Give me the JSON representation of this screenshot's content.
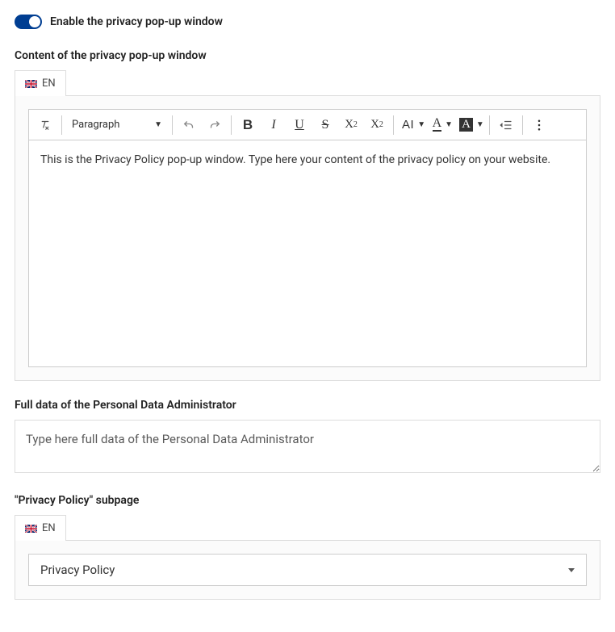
{
  "toggle": {
    "label": "Enable the privacy pop-up window",
    "enabled": true
  },
  "content_section": {
    "label": "Content of the privacy pop-up window",
    "lang_tab": "EN",
    "toolbar": {
      "paragraph": "Paragraph",
      "clear_format": "clear-formatting-icon",
      "undo": "undo-icon",
      "redo": "redo-icon",
      "bold": "B",
      "italic": "I",
      "underline": "U",
      "strike": "S",
      "subscript": "X",
      "subscript_sub": "2",
      "superscript": "X",
      "superscript_sup": "2",
      "case": "AI",
      "textcolor": "A",
      "bgcolor": "A",
      "outdent": "outdent-icon",
      "ellipsis": "more-icon"
    },
    "body_text": "This is the Privacy Policy pop-up window. Type here your content of the privacy policy on your website."
  },
  "admin_section": {
    "label": "Full data of the Personal Data Administrator",
    "placeholder": "Type here full data of the Personal Data Administrator"
  },
  "subpage_section": {
    "label": "\"Privacy Policy\" subpage",
    "lang_tab": "EN",
    "selected": "Privacy Policy"
  }
}
